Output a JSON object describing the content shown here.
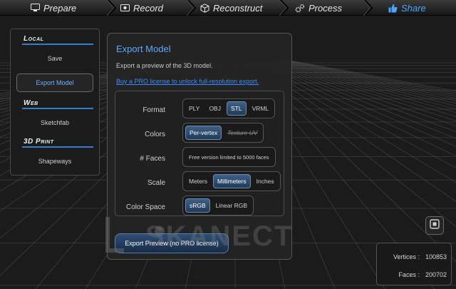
{
  "workflow": {
    "steps": [
      {
        "label": "Prepare",
        "icon": "monitor-icon"
      },
      {
        "label": "Record",
        "icon": "record-icon"
      },
      {
        "label": "Reconstruct",
        "icon": "cube-icon"
      },
      {
        "label": "Process",
        "icon": "gears-icon"
      },
      {
        "label": "Share",
        "icon": "thumbs-up-icon"
      }
    ],
    "active": "Share",
    "accent": "#4ca3ff"
  },
  "sidebar": {
    "local_title": "Local",
    "local_items": [
      "Save",
      "Export Model"
    ],
    "web_title": "Web",
    "web_items": [
      "Sketchfab"
    ],
    "print_title": "3D Print",
    "print_items": [
      "Shapeways"
    ],
    "selected": "Export Model"
  },
  "panel": {
    "title": "Export Model",
    "description": "Export a preview of the 3D model.",
    "link": "Buy a PRO license to unlock full-resolution export.",
    "format_label": "Format",
    "format_options": [
      "PLY",
      "OBJ",
      "STL",
      "VRML"
    ],
    "format_selected": "STL",
    "colors_label": "Colors",
    "colors_options": [
      "Per-vertex",
      "Texture UV"
    ],
    "colors_selected": "Per-vertex",
    "faces_label": "# Faces",
    "faces_note": "Free version limited to 5000 faces",
    "scale_label": "Scale",
    "scale_options": [
      "Meters",
      "Millimeters",
      "Inches"
    ],
    "scale_selected": "Millimeters",
    "colorspace_label": "Color Space",
    "colorspace_options": [
      "sRGB",
      "Linear RGB"
    ],
    "colorspace_selected": "sRGB",
    "export_button": "Export Preview (no PRO license)"
  },
  "watermark": "SKANECT",
  "stats": {
    "vertices_label": "Vertices :",
    "vertices_value": "100853",
    "faces_label": "Faces :",
    "faces_value": "200702"
  }
}
